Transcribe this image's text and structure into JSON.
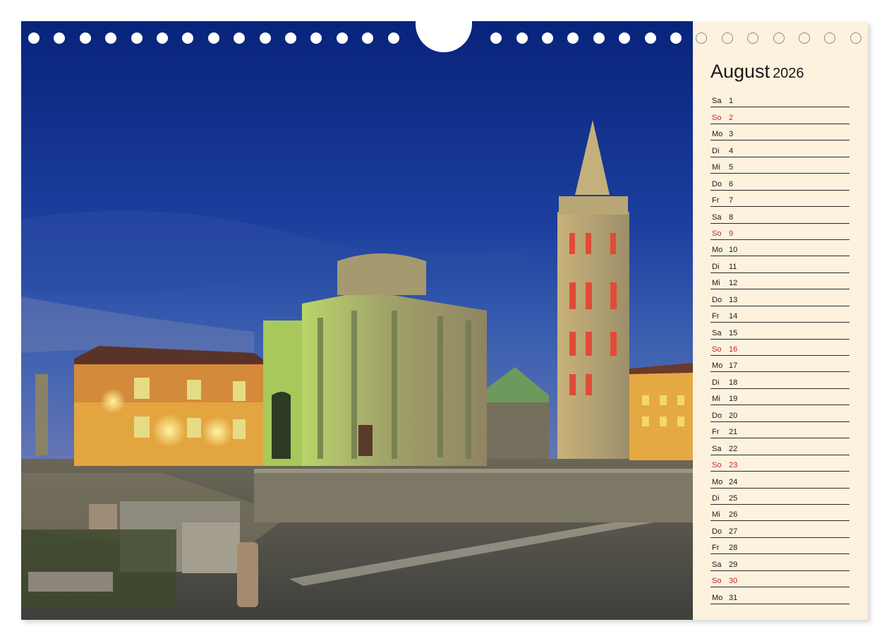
{
  "calendar": {
    "month": "August",
    "year": "2026",
    "sunday_color": "#c0282d",
    "days": [
      {
        "name": "Sa",
        "num": "1"
      },
      {
        "name": "So",
        "num": "2",
        "sunday": true
      },
      {
        "name": "Mo",
        "num": "3"
      },
      {
        "name": "Di",
        "num": "4"
      },
      {
        "name": "Mi",
        "num": "5"
      },
      {
        "name": "Do",
        "num": "6"
      },
      {
        "name": "Fr",
        "num": "7"
      },
      {
        "name": "Sa",
        "num": "8"
      },
      {
        "name": "So",
        "num": "9",
        "sunday": true
      },
      {
        "name": "Mo",
        "num": "10"
      },
      {
        "name": "Di",
        "num": "11"
      },
      {
        "name": "Mi",
        "num": "12"
      },
      {
        "name": "Do",
        "num": "13"
      },
      {
        "name": "Fr",
        "num": "14"
      },
      {
        "name": "Sa",
        "num": "15"
      },
      {
        "name": "So",
        "num": "16",
        "sunday": true
      },
      {
        "name": "Mo",
        "num": "17"
      },
      {
        "name": "Di",
        "num": "18"
      },
      {
        "name": "Mi",
        "num": "19"
      },
      {
        "name": "Do",
        "num": "20"
      },
      {
        "name": "Fr",
        "num": "21"
      },
      {
        "name": "Sa",
        "num": "22"
      },
      {
        "name": "So",
        "num": "23",
        "sunday": true
      },
      {
        "name": "Mo",
        "num": "24"
      },
      {
        "name": "Di",
        "num": "25"
      },
      {
        "name": "Mi",
        "num": "26"
      },
      {
        "name": "Do",
        "num": "27"
      },
      {
        "name": "Fr",
        "num": "28"
      },
      {
        "name": "Sa",
        "num": "29"
      },
      {
        "name": "So",
        "num": "30",
        "sunday": true
      },
      {
        "name": "Mo",
        "num": "31"
      }
    ]
  },
  "colors": {
    "panel_bg": "#fdf2de",
    "sky": "#0d2a8a",
    "floodlight": "#e9c36a"
  }
}
